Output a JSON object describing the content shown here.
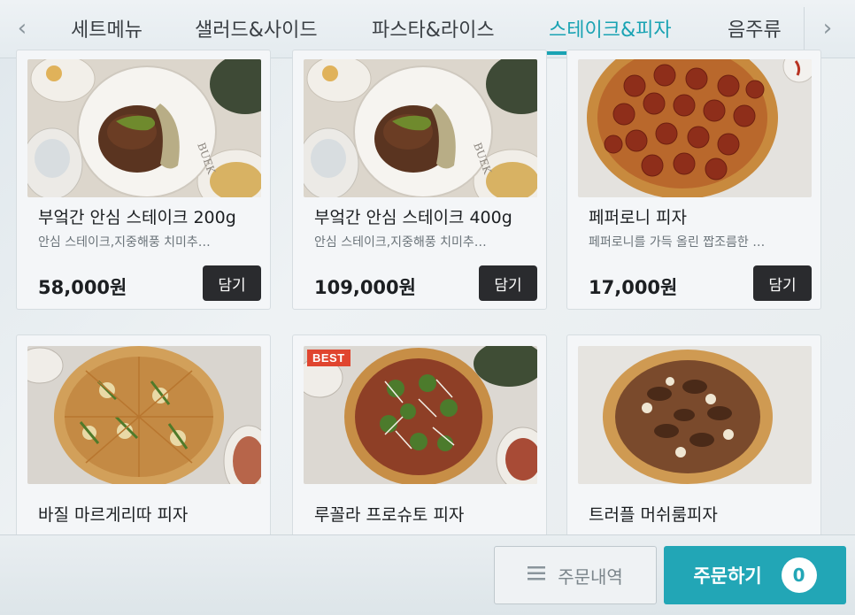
{
  "categories": {
    "tabs": [
      {
        "label": "세트메뉴"
      },
      {
        "label": "샐러드&사이드"
      },
      {
        "label": "파스타&라이스"
      },
      {
        "label": "스테이크&피자"
      },
      {
        "label": "음주류"
      }
    ],
    "active_index": 3,
    "prev_icon": "chevron-left-icon",
    "next_icon": "chevron-right-icon"
  },
  "products": [
    {
      "name": "부엌간 안심 스테이크 200g",
      "desc": "안심 스테이크,지중해풍 치미추…",
      "price": "58,000원",
      "add_label": "담기",
      "image": "steak-plate"
    },
    {
      "name": "부엌간 안심 스테이크 400g",
      "desc": "안심 스테이크,지중해풍 치미추…",
      "price": "109,000원",
      "add_label": "담기",
      "image": "steak-plate"
    },
    {
      "name": "페퍼로니 피자",
      "desc": "페퍼로니를 가득 올린 짭조름한 …",
      "price": "17,000원",
      "add_label": "담기",
      "image": "pepperoni-pizza"
    },
    {
      "name": "바질 마르게리따 피자",
      "badge": "",
      "image": "basil-pizza"
    },
    {
      "name": "루꼴라 프로슈토 피자",
      "badge": "BEST",
      "image": "arugula-pizza"
    },
    {
      "name": "트러플 머쉬룸피자",
      "badge": "",
      "image": "truffle-pizza"
    }
  ],
  "footer": {
    "history_label": "주문내역",
    "order_label": "주문하기",
    "order_count": "0",
    "history_icon": "list-icon"
  },
  "colors": {
    "accent": "#1aa3b3",
    "button_dark": "#2a2b2e",
    "badge": "#e0452f"
  }
}
